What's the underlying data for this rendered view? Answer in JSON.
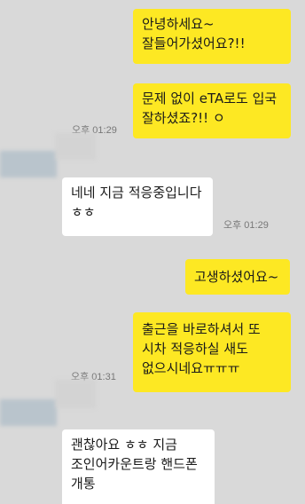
{
  "messages": [
    {
      "from": "me",
      "text": "안녕하세요~ 잘들어가셨어요?!!"
    },
    {
      "from": "me",
      "text": "문제 없이 eTA로도 입국 잘하셨죠?!! ㅇ"
    },
    {
      "from": "me_time",
      "text": "오후 01:29"
    },
    {
      "from": "them",
      "text": "네네 지금 적응중입니다 ㅎㅎ"
    },
    {
      "from": "them_time",
      "text": "오후 01:29"
    },
    {
      "from": "me",
      "text": "고생하셨어요~"
    },
    {
      "from": "me",
      "text": "출근을 바로하셔서 또 시차 적응하실 새도 없으시네요ㅠㅠㅠ"
    },
    {
      "from": "me_time",
      "text": "오후 01:31"
    },
    {
      "from": "them",
      "text": "괜찮아요 ㅎㅎ 지금 조인어카운트랑 핸드폰 개통"
    }
  ],
  "colors": {
    "background": "#d9d9d9",
    "my_bubble": "#fde823",
    "their_bubble": "#ffffff",
    "timestamp": "#777777"
  }
}
